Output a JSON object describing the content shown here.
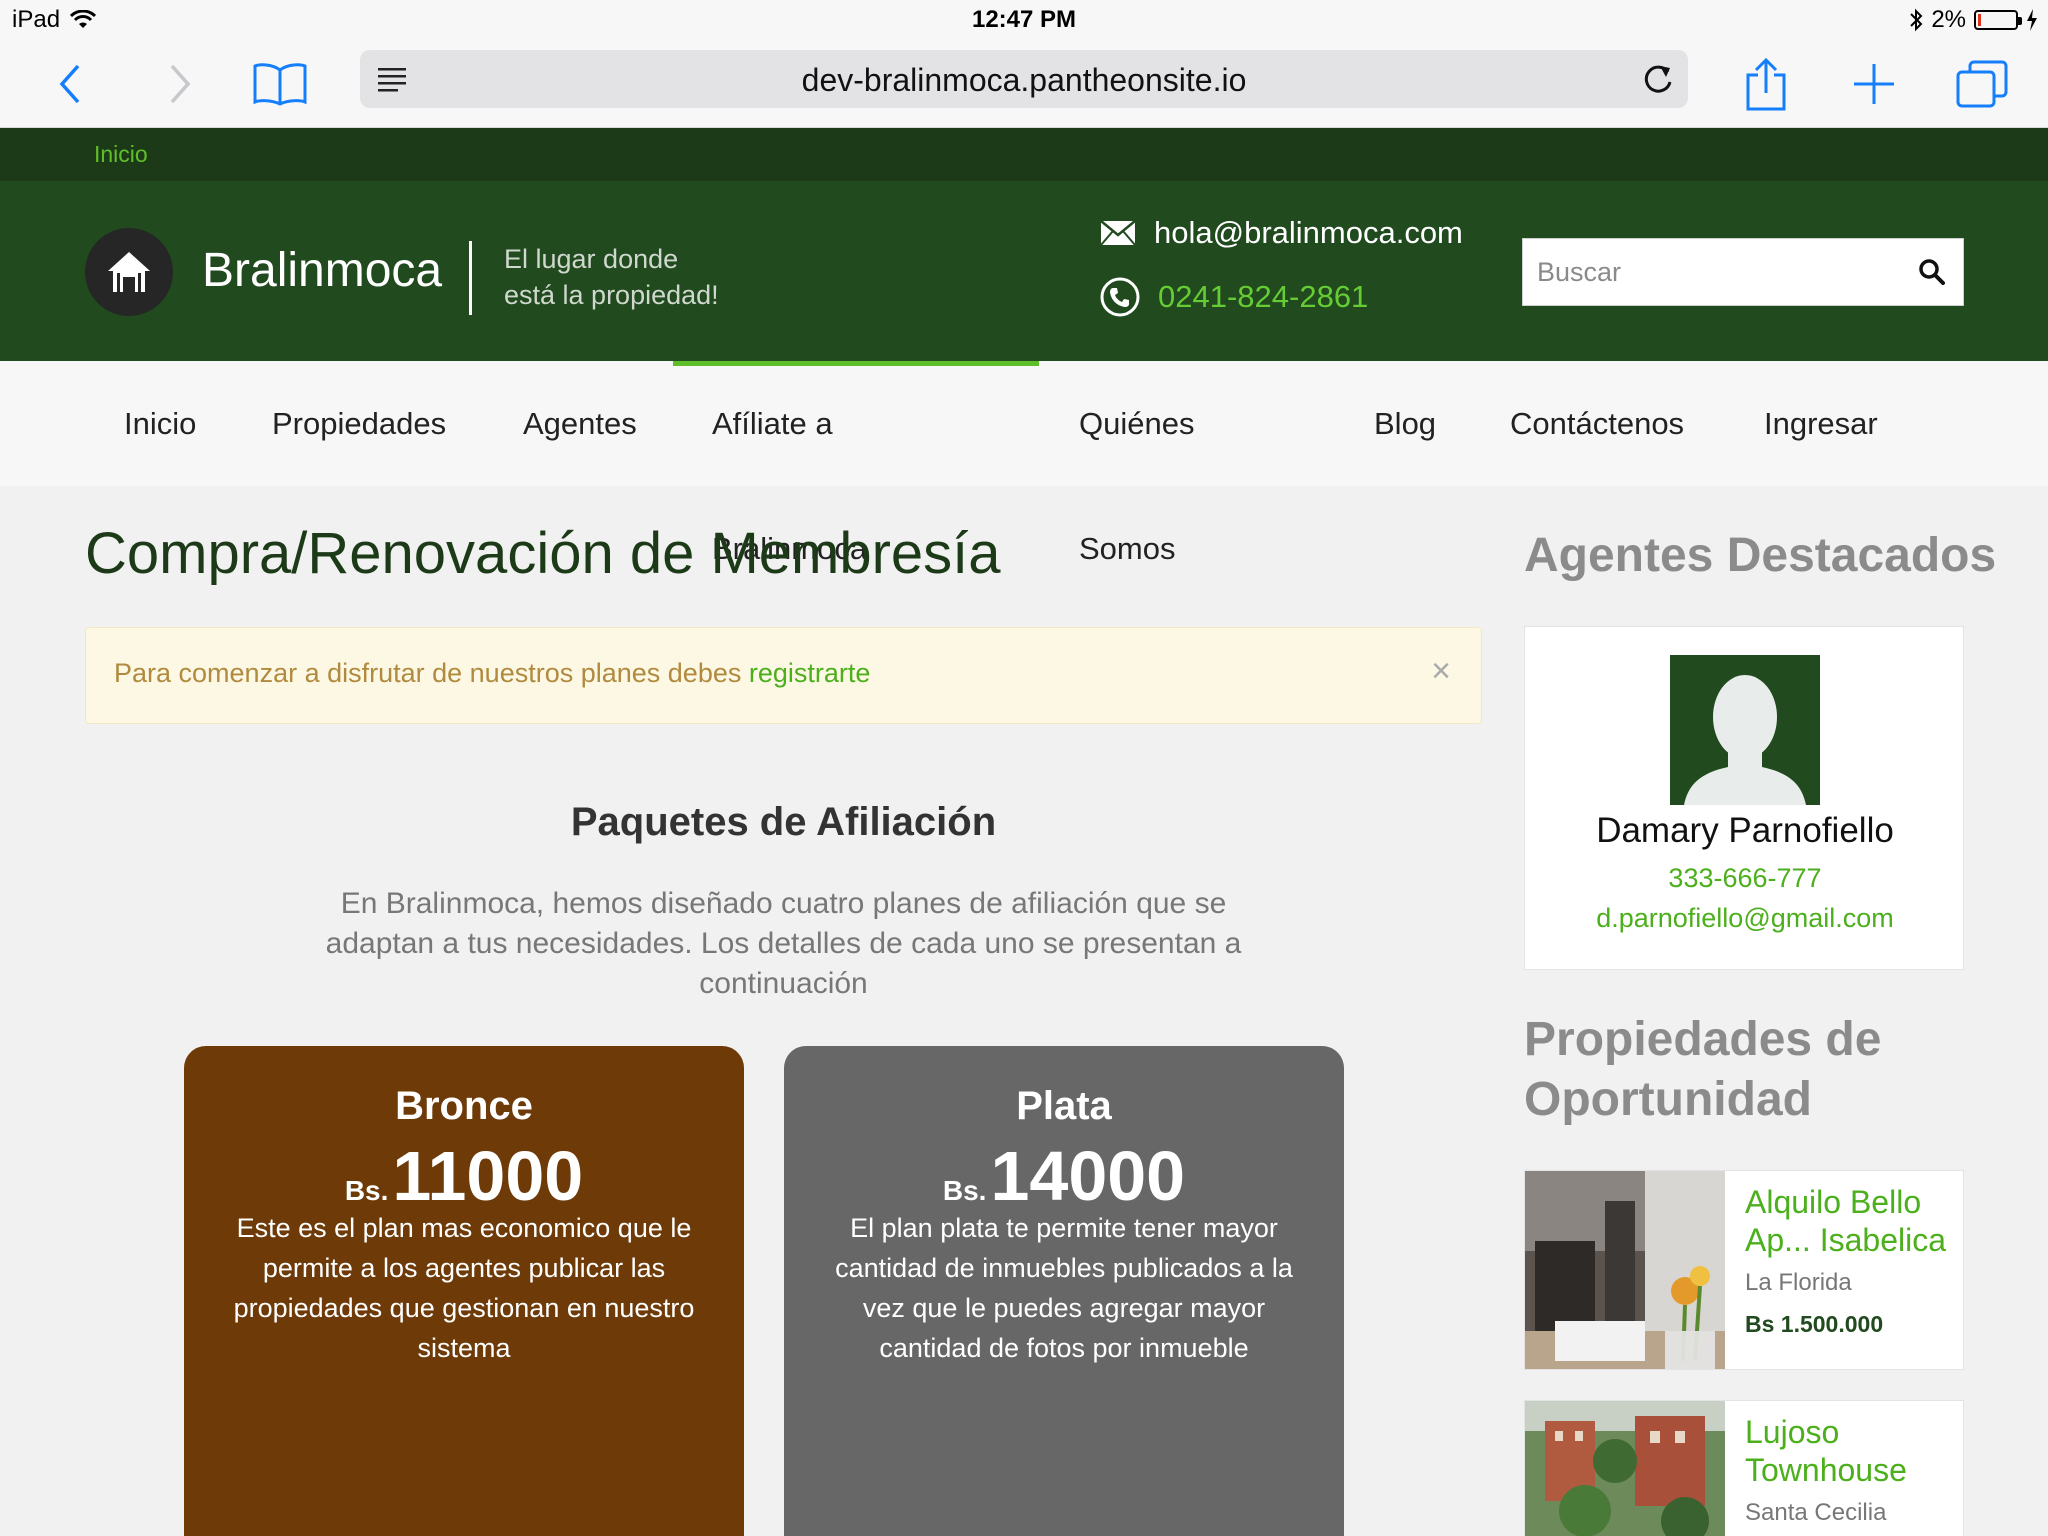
{
  "status_bar": {
    "device": "iPad",
    "time": "12:47 PM",
    "battery": "2%"
  },
  "browser": {
    "url": "dev-bralinmoca.pantheonsite.io"
  },
  "breadcrumb": {
    "home": "Inicio"
  },
  "header": {
    "brand": "Bralinmoca",
    "tagline_line1": "El lugar donde",
    "tagline_line2": "está la propiedad!",
    "email": "hola@bralinmoca.com",
    "phone": "0241-824-2861",
    "search_placeholder": "Buscar"
  },
  "nav": {
    "items": [
      {
        "label": "Inicio"
      },
      {
        "label": "Propiedades"
      },
      {
        "label": "Agentes"
      },
      {
        "label": "Afíliate a Bralinmoca"
      },
      {
        "label": "Quiénes Somos"
      },
      {
        "label": "Blog"
      },
      {
        "label": "Contáctenos"
      },
      {
        "label": "Ingresar"
      }
    ],
    "active": "Afíliate a Bralinmoca"
  },
  "main": {
    "title": "Compra/Renovación de Membresía",
    "alert": {
      "text": "Para comenzar a disfrutar de nuestros planes debes ",
      "link": "registrarte",
      "close": "×"
    },
    "section_title": "Paquetes de Afiliación",
    "section_desc": "En Bralinmoca, hemos diseñado cuatro planes de afiliación que se adaptan a tus necesidades. Los detalles de cada uno se presentan a continuación",
    "plans": [
      {
        "name": "Bronce",
        "currency": "Bs.",
        "price": "11000",
        "description": "Este es el plan mas economico que le permite a los agentes publicar las propiedades que gestionan en nuestro sistema",
        "color": "#6e3a08"
      },
      {
        "name": "Plata",
        "currency": "Bs.",
        "price": "14000",
        "description": "El plan plata te permite tener mayor cantidad de inmuebles publicados a la vez que le puedes agregar mayor cantidad de fotos por inmueble",
        "color": "#676767"
      }
    ]
  },
  "sidebar": {
    "agents_title": "Agentes Destacados",
    "agent": {
      "name": "Damary Parnofiello",
      "phone": "333-666-777",
      "email": "d.parnofiello@gmail.com"
    },
    "properties_title": "Propiedades de Oportunidad",
    "properties": [
      {
        "title": "Alquilo Bello Ap... Isabelica",
        "location": "La Florida",
        "price": "Bs 1.500.000"
      },
      {
        "title": "Lujoso Townhouse",
        "location": "Santa Cecilia",
        "price": ""
      }
    ]
  },
  "colors": {
    "header_green": "#214a1f",
    "breadcrumb_green": "#1d3a18",
    "accent_green": "#5fbf2b",
    "bronze": "#6e3a08",
    "silver": "#676767",
    "ios_blue": "#157efb"
  }
}
